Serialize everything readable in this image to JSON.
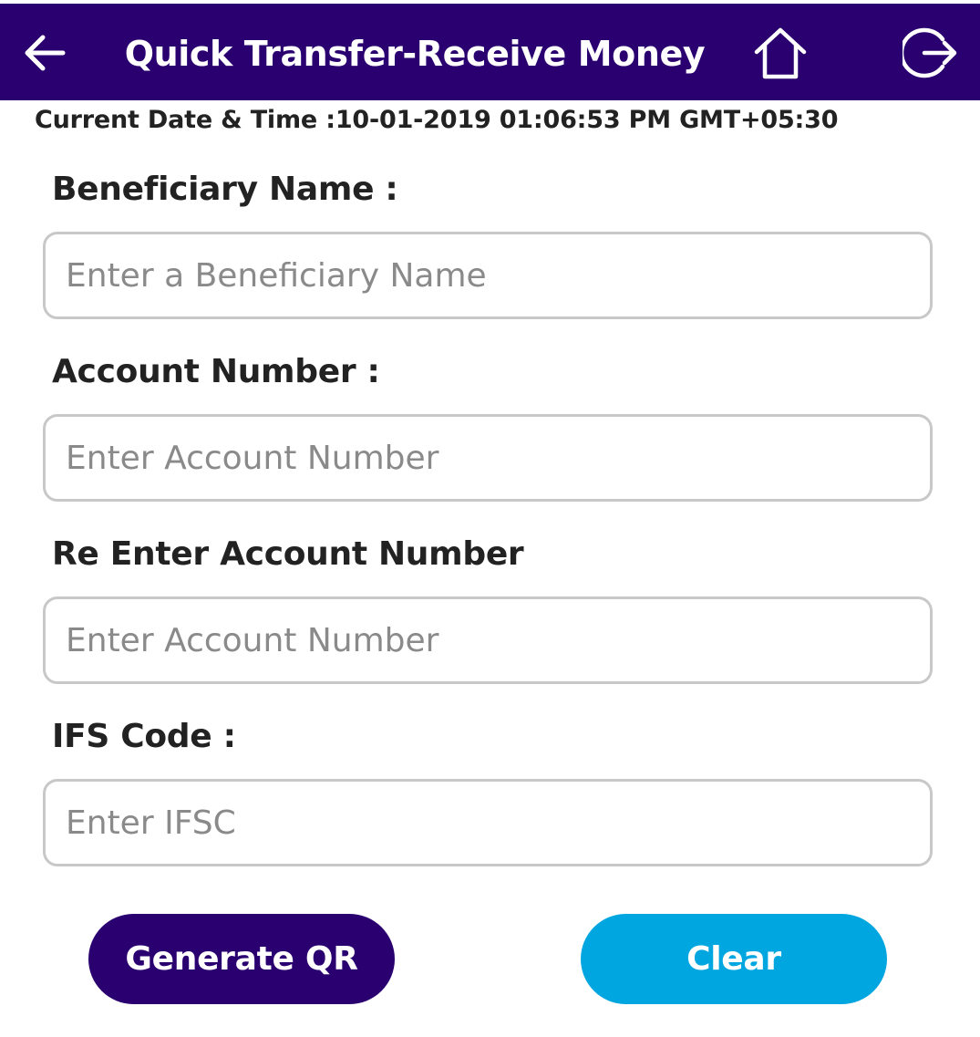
{
  "header": {
    "title": "Quick Transfer-Receive Money",
    "back_icon": "arrow-left-icon",
    "home_icon": "home-icon",
    "logout_icon": "logout-icon"
  },
  "datetime": {
    "text": "Current Date & Time :10-01-2019 01:06:53 PM GMT+05:30"
  },
  "form": {
    "beneficiary_name": {
      "label": "Beneficiary Name :",
      "value": "",
      "placeholder": "Enter a Beneficiary Name"
    },
    "account_number": {
      "label": "Account Number :",
      "value": "",
      "placeholder": "Enter Account Number"
    },
    "reenter_account_number": {
      "label": "Re Enter Account Number",
      "value": "",
      "placeholder": "Enter Account Number"
    },
    "ifs_code": {
      "label": "IFS Code :",
      "value": "",
      "placeholder": "Enter IFSC"
    }
  },
  "actions": {
    "generate_qr_label": "Generate QR",
    "clear_label": "Clear"
  },
  "colors": {
    "header_bg": "#2a0070",
    "primary_button": "#2a0070",
    "secondary_button": "#00a6e0",
    "field_border": "#c8c8c8",
    "placeholder": "#8a8a8a"
  }
}
